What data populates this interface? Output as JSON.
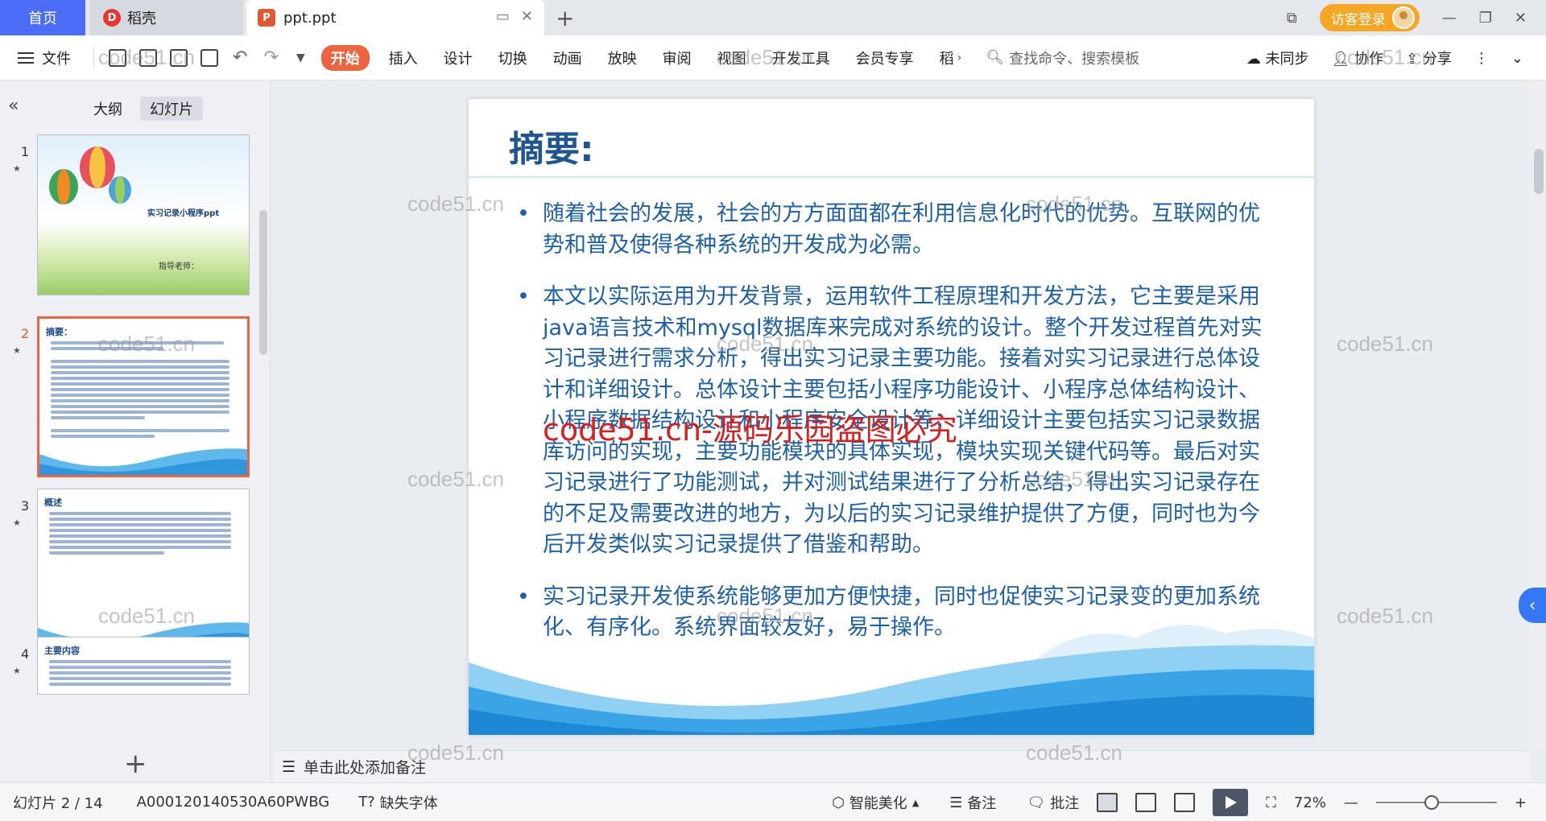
{
  "tabs": {
    "home": "首页",
    "daoke": "稻壳",
    "file": "ppt.ppt"
  },
  "window": {
    "login": "访客登录"
  },
  "ribbon": {
    "file_menu": "文件",
    "tabs": [
      "开始",
      "插入",
      "设计",
      "切换",
      "动画",
      "放映",
      "审阅",
      "视图",
      "开发工具",
      "会员专享",
      "稻"
    ],
    "search_placeholder": "查找命令、搜索模板",
    "sync": "未同步",
    "collab": "协作",
    "share": "分享"
  },
  "panel": {
    "view_outline": "大纲",
    "view_slides": "幻灯片",
    "thumbnails": [
      {
        "num": "1",
        "title": "实习记录小程序ppt",
        "subtitle": "指导老师："
      },
      {
        "num": "2",
        "title": "摘要："
      },
      {
        "num": "3",
        "title": "概述"
      },
      {
        "num": "4",
        "title": "主要内容"
      }
    ]
  },
  "slide": {
    "title": "摘要:",
    "bullets": [
      "随着社会的发展，社会的方方面面都在利用信息化时代的优势。互联网的优势和普及使得各种系统的开发成为必需。",
      "本文以实际运用为开发背景，运用软件工程原理和开发方法，它主要是采用java语言技术和mysql数据库来完成对系统的设计。整个开发过程首先对实习记录进行需求分析，得出实习记录主要功能。接着对实习记录进行总体设计和详细设计。总体设计主要包括小程序功能设计、小程序总体结构设计、小程序数据结构设计和小程序安全设计等；详细设计主要包括实习记录数据库访问的实现，主要功能模块的具体实现，模块实现关键代码等。最后对实习记录进行了功能测试，并对测试结果进行了分析总结，得出实习记录存在的不足及需要改进的地方，为以后的实习记录维护提供了方便，同时也为今后开发类似实习记录提供了借鉴和帮助。",
      "实习记录开发使系统能够更加方便快捷，同时也促使实习记录变的更加系统化、有序化。系统界面较友好，易于操作。"
    ],
    "watermark": "code51.cn-源码乐园盗图必究"
  },
  "notes": "单击此处添加备注",
  "status": {
    "slide_counter": "幻灯片 2 / 14",
    "doc_id": "A000120140530A60PWBG",
    "missing_font": "缺失字体",
    "beautify": "智能美化",
    "notes_btn": "备注",
    "comment_btn": "批注",
    "zoom": "72%"
  },
  "watermark_text": "code51.cn"
}
